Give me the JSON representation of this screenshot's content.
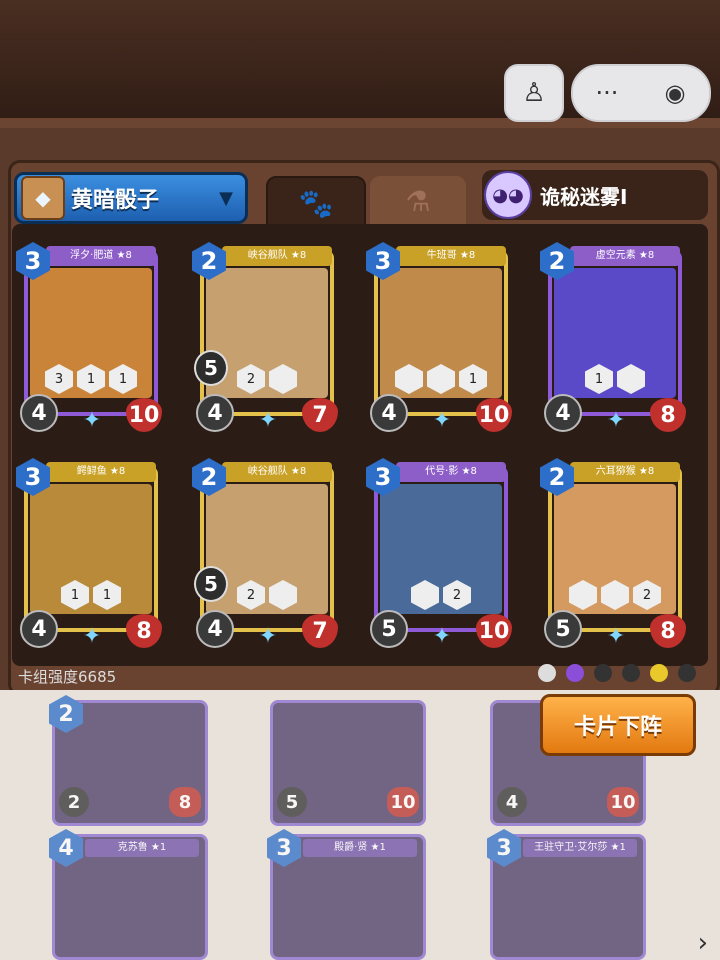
{
  "header": {
    "person_icon": "person-pin-icon",
    "menu_dots": "···",
    "target_icon": "◉"
  },
  "deck": {
    "name": "黄暗骰子",
    "strength_label": "卡组强度6685"
  },
  "opponent": {
    "name": "诡秘迷雾Ⅰ"
  },
  "tabs": [
    {
      "icon": "🐾"
    },
    {
      "icon": "⚗"
    }
  ],
  "cards": [
    {
      "title": "浮夕·肥道 ★8",
      "cost": "3",
      "atk": "4",
      "hp": "10",
      "skills": [
        "3",
        "1",
        "1"
      ],
      "theme": "purple"
    },
    {
      "title": "峡谷舰队 ★8",
      "cost": "2",
      "atk": "4",
      "hp": "7",
      "skills": [
        "2",
        ""
      ],
      "shield": "5",
      "theme": "gold"
    },
    {
      "title": "牛班哥 ★8",
      "cost": "3",
      "atk": "4",
      "hp": "10",
      "skills": [
        "",
        "",
        "1"
      ],
      "theme": "gold"
    },
    {
      "title": "虚空元素 ★8",
      "cost": "2",
      "atk": "4",
      "hp": "8",
      "skills": [
        "1",
        ""
      ],
      "theme": "purple"
    },
    {
      "title": "鳄鲟鱼 ★8",
      "cost": "3",
      "atk": "4",
      "hp": "8",
      "skills": [
        "1",
        "1"
      ],
      "theme": "gold"
    },
    {
      "title": "峡谷舰队 ★8",
      "cost": "2",
      "atk": "4",
      "hp": "7",
      "skills": [
        "2",
        ""
      ],
      "shield": "5",
      "theme": "gold"
    },
    {
      "title": "代号·影 ★8",
      "cost": "3",
      "atk": "5",
      "hp": "10",
      "skills": [
        "",
        "2"
      ],
      "theme": "purple"
    },
    {
      "title": "六耳猕猴 ★8",
      "cost": "2",
      "atk": "5",
      "hp": "8",
      "skills": [
        "",
        "",
        "2"
      ],
      "theme": "gold"
    }
  ],
  "unequip_button": "卡片下阵",
  "collection": [
    {
      "title": "",
      "cost": "2",
      "atk": "2",
      "hp": "8"
    },
    {
      "title": "",
      "cost": "",
      "atk": "5",
      "hp": "10"
    },
    {
      "title": "",
      "cost": "",
      "atk": "4",
      "hp": "10"
    },
    {
      "title": "克苏鲁 ★1",
      "cost": "4",
      "atk": "",
      "hp": ""
    },
    {
      "title": "殿爵·贤 ★1",
      "cost": "3",
      "atk": "",
      "hp": ""
    },
    {
      "title": "王驻守卫·艾尔莎 ★1",
      "cost": "3",
      "atk": "",
      "hp": ""
    }
  ],
  "next_arrow": "›"
}
